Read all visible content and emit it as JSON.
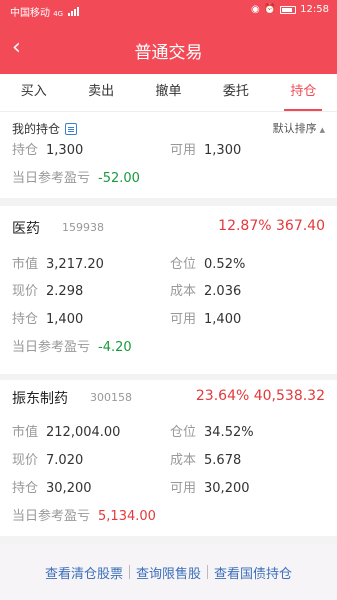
{
  "status": {
    "carrier": "中国移动",
    "signal": "4G",
    "time": "12:58"
  },
  "nav": {
    "back_icon": "chevron-left-icon",
    "title": "普通交易"
  },
  "tabs": [
    {
      "label": "买入"
    },
    {
      "label": "卖出"
    },
    {
      "label": "撤单"
    },
    {
      "label": "委托"
    },
    {
      "label": "持仓",
      "active": true
    }
  ],
  "summary": {
    "title": "我的持仓",
    "sort_label": "默认排序",
    "hold_label": "持仓",
    "hold_value": "1,300",
    "avail_label": "可用",
    "avail_value": "1,300",
    "pl_label": "当日参考盈亏",
    "pl_value": "-52.00"
  },
  "positions": [
    {
      "name": "医药",
      "code": "159938",
      "pl_pct": "12.87%",
      "pl_amount": "367.40",
      "market_value_label": "市值",
      "market_value": "3,217.20",
      "weight_label": "仓位",
      "weight": "0.52%",
      "price_label": "现价",
      "price": "2.298",
      "cost_label": "成本",
      "cost": "2.036",
      "hold_label": "持仓",
      "hold": "1,400",
      "avail_label": "可用",
      "avail": "1,400",
      "day_pl_label": "当日参考盈亏",
      "day_pl": "-4.20"
    },
    {
      "name": "振东制药",
      "code": "300158",
      "pl_pct": "23.64%",
      "pl_amount": "40,538.32",
      "market_value_label": "市值",
      "market_value": "212,004.00",
      "weight_label": "仓位",
      "weight": "34.52%",
      "price_label": "现价",
      "price": "7.020",
      "cost_label": "成本",
      "cost": "5.678",
      "hold_label": "持仓",
      "hold": "30,200",
      "avail_label": "可用",
      "avail": "30,200",
      "day_pl_label": "当日参考盈亏",
      "day_pl": "5,134.00"
    }
  ],
  "footer": {
    "link1": "查看清仓股票",
    "link2": "查询限售股",
    "link3": "查看国债持仓"
  },
  "colors": {
    "brand": "#f24b57",
    "gain": "#e4393c",
    "loss": "#1a9a3e",
    "link": "#3b6fb8"
  }
}
